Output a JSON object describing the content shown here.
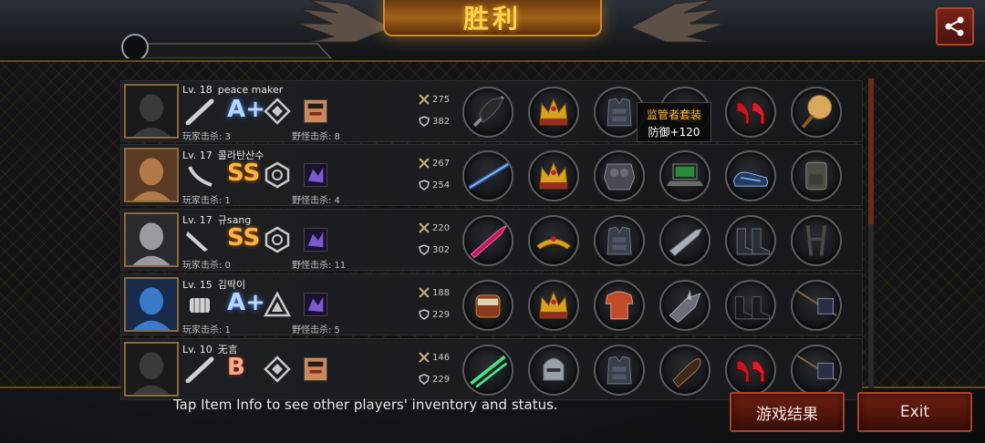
{
  "header": {
    "title": "胜利",
    "share_icon": "share-icon"
  },
  "players": [
    {
      "level": "Lv. 18",
      "name": "peace maker",
      "weapon_icon": "bat-weapon-icon",
      "rank": "A+",
      "emblem_icon": "diamond-emblem-icon",
      "pet_icon": "fighter-portrait-icon",
      "player_kills_label": "玩家击杀: 3",
      "monster_kills_label": "野怪击杀: 8",
      "attack": "275",
      "defense": "382",
      "items": [
        "umbrella-icon",
        "crown-icon",
        "vest-armor-icon",
        "yellow-hat-icon",
        "red-high-heels-icon",
        "round-fan-icon"
      ]
    },
    {
      "level": "Lv. 17",
      "name": "콜라탄산수",
      "weapon_icon": "curved-blade-icon",
      "rank": "SS",
      "emblem_icon": "hexagon-emblem-icon",
      "pet_icon": "purple-beast-icon",
      "player_kills_label": "玩家击杀: 1",
      "monster_kills_label": "野怪击杀: 4",
      "attack": "267",
      "defense": "254",
      "items": [
        "laser-rifle-icon",
        "crown-icon",
        "plate-armor-icon",
        "laptop-icon",
        "blue-sneakers-icon",
        "backpack-icon"
      ]
    },
    {
      "level": "Lv. 17",
      "name": "규sang",
      "weapon_icon": "knife-icon",
      "rank": "SS",
      "emblem_icon": "hexagon-emblem-icon",
      "pet_icon": "purple-beast-icon",
      "player_kills_label": "玩家击杀: 0",
      "monster_kills_label": "野怪击杀: 11",
      "attack": "220",
      "defense": "302",
      "items": [
        "crystal-sword-icon",
        "golden-tiara-icon",
        "vest-armor-icon",
        "blade-arm-icon",
        "combat-boots-icon",
        "suspenders-icon"
      ]
    },
    {
      "level": "Lv. 15",
      "name": "김딱이",
      "weapon_icon": "gauntlet-icon",
      "rank": "A+",
      "emblem_icon": "triangle-emblem-icon",
      "pet_icon": "purple-beast-icon",
      "player_kills_label": "玩家击杀: 1",
      "monster_kills_label": "野怪击杀: 5",
      "attack": "188",
      "defense": "229",
      "items": [
        "power-gauntlet-icon",
        "crown-icon",
        "red-shirt-icon",
        "spiked-arm-icon",
        "black-boots-icon",
        "flag-spear-icon"
      ]
    },
    {
      "level": "Lv. 10",
      "name": "无言",
      "weapon_icon": "bat-weapon-icon",
      "rank": "B",
      "emblem_icon": "diamond-emblem-icon",
      "pet_icon": "fighter-portrait-icon",
      "player_kills_label": "",
      "monster_kills_label": "",
      "attack": "146",
      "defense": "229",
      "items": [
        "green-swords-icon",
        "knight-helmet-icon",
        "vest-armor-icon",
        "bullet-icon",
        "red-high-heels-icon",
        "flag-spear-icon"
      ]
    }
  ],
  "tooltip": {
    "name": "监管者套装",
    "effect": "防御+120"
  },
  "footer": {
    "hint": "Tap Item Info to see other players' inventory and status.",
    "results_button": "游戏结果",
    "exit_button": "Exit"
  },
  "colors": {
    "accent_gold": "#ffd24a",
    "button_red": "#6a1e12",
    "tooltip_orange": "#ffb640"
  }
}
